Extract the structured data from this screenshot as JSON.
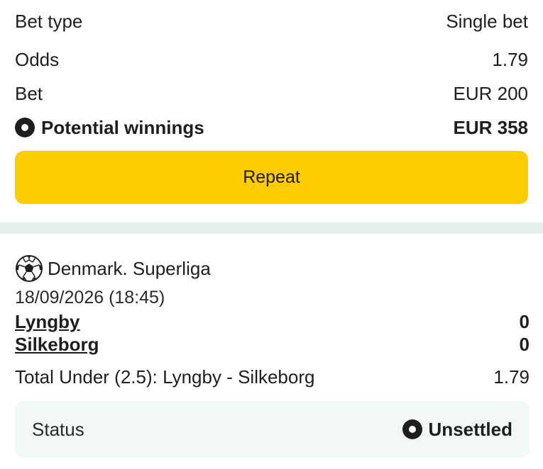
{
  "bet_summary": {
    "bet_type_label": "Bet type",
    "bet_type_value": "Single bet",
    "odds_label": "Odds",
    "odds_value": "1.79",
    "bet_label": "Bet",
    "bet_value": "EUR 200",
    "potential_label": "Potential winnings",
    "potential_value": "EUR 358",
    "status_dot_icon": "record-circle-icon"
  },
  "repeat_button": {
    "label": "Repeat",
    "color": "#fccb00"
  },
  "event": {
    "sport_icon": "soccer-ball-icon",
    "league": "Denmark. Superliga",
    "datetime": "18/09/2026 (18:45)",
    "teams": [
      {
        "name": "Lyngby",
        "score": "0"
      },
      {
        "name": "Silkeborg",
        "score": "0"
      }
    ],
    "selection": "Total Under (2.5): Lyngby - Silkeborg",
    "selection_odds": "1.79",
    "status_label": "Status",
    "status_value": "Unsettled",
    "status_icon": "record-circle-icon"
  },
  "colors": {
    "accent": "#fccb00",
    "divider": "#e8efed",
    "status_box_bg": "#f1f8f5",
    "text": "#1e1e1e"
  }
}
